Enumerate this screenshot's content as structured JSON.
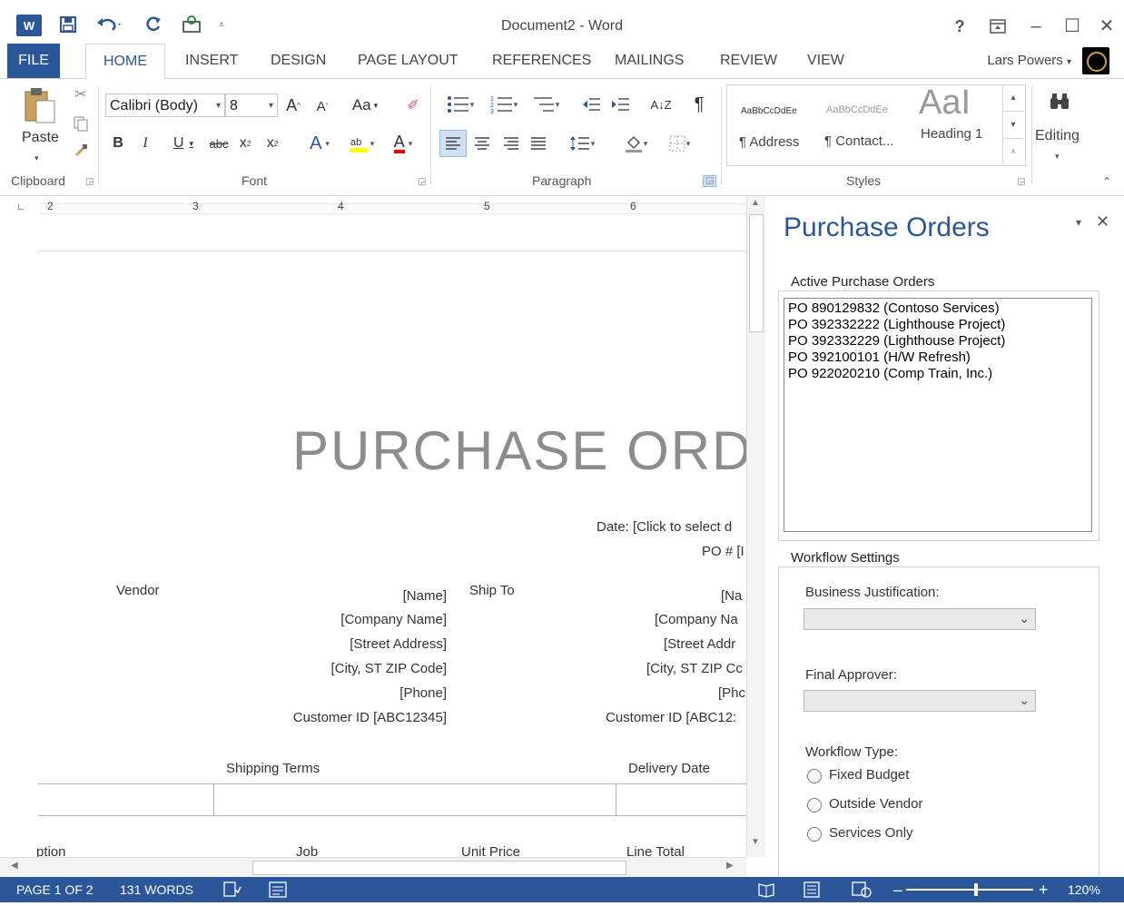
{
  "window": {
    "title": "Document2 - Word"
  },
  "quick_access": {
    "word_icon": "W",
    "save_icon": "save-icon",
    "undo_icon": "undo-icon",
    "redo_icon": "redo-icon",
    "customize_icon": "customize-icon"
  },
  "window_controls": {
    "help": "?",
    "minimize": "–",
    "maximize": "☐",
    "close": "✕",
    "ribbon_options": "⊼"
  },
  "tabs": [
    "FILE",
    "HOME",
    "INSERT",
    "DESIGN",
    "PAGE LAYOUT",
    "REFERENCES",
    "MAILINGS",
    "REVIEW",
    "VIEW"
  ],
  "user": {
    "name": "Lars Powers"
  },
  "ribbon": {
    "clipboard": {
      "label": "Clipboard",
      "paste": "Paste"
    },
    "font": {
      "label": "Font",
      "family": "Calibri (Body)",
      "size": "8",
      "change_case": "Aa"
    },
    "paragraph": {
      "label": "Paragraph",
      "pilcrow": "¶",
      "sort": "A↓Z"
    },
    "styles": {
      "label": "Styles",
      "items": [
        {
          "preview": "AaBbCcDdEe",
          "name": "¶ Address"
        },
        {
          "preview": "AaBbCcDdEe",
          "name": "¶ Contact..."
        },
        {
          "preview": "AaI",
          "name": "Heading 1"
        }
      ]
    },
    "editing": {
      "label": "Editing"
    }
  },
  "ruler": {
    "numbers": [
      "2",
      "3",
      "4",
      "5",
      "6"
    ]
  },
  "document": {
    "heading": "PURCHASE ORDEI",
    "date_line": "Date: [Click to select d",
    "po_line": "PO # [I",
    "vendor_label": "Vendor",
    "ship_to_label": "Ship To",
    "vendor_fields": [
      "[Name]",
      "[Company Name]",
      "[Street Address]",
      "[City, ST  ZIP Code]",
      "[Phone]",
      "Customer ID [ABC12345]"
    ],
    "ship_fields": [
      "[Na",
      "[Company Na",
      "[Street Addr",
      "[City, ST  ZIP Cc",
      "[Phc",
      "Customer ID [ABC12:"
    ],
    "shipping_terms": "Shipping Terms",
    "delivery_date": "Delivery Date",
    "table_headers": [
      "ption",
      "Job",
      "Unit Price",
      "Line Total"
    ]
  },
  "task_pane": {
    "title": "Purchase Orders",
    "active_legend": "Active Purchase Orders",
    "purchase_orders": [
      "PO 890129832 (Contoso Services)",
      "PO 392332222 (Lighthouse Project)",
      "PO 392332229 (Lighthouse Project)",
      "PO 392100101 (H/W Refresh)",
      "PO 922020210 (Comp Train, Inc.)"
    ],
    "workflow_legend": "Workflow Settings",
    "business_justification_label": "Business Justification:",
    "final_approver_label": "Final Approver:",
    "workflow_type_label": "Workflow Type:",
    "workflow_types": [
      "Fixed Budget",
      "Outside Vendor",
      "Services Only"
    ]
  },
  "status_bar": {
    "page": "PAGE 1 OF 2",
    "words": "131 WORDS",
    "zoom": "120%",
    "zoom_level_fraction": 0.55,
    "accent": "#2b579a"
  }
}
